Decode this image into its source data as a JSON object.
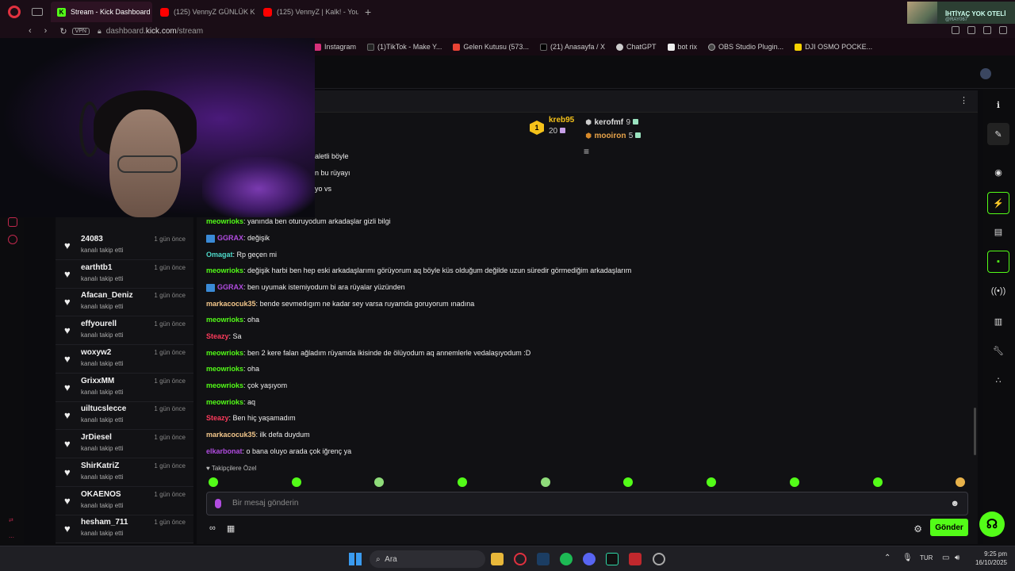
{
  "browser": {
    "tabs": [
      {
        "label": "Stream - Kick Dashboard",
        "icon": "kick-icon",
        "active": true
      },
      {
        "label": "(125) VennyZ GÜNLÜK K",
        "icon": "youtube-icon",
        "active": false
      },
      {
        "label": "(125) VennyZ | Kalk! - You",
        "icon": "youtube-icon",
        "active": false
      }
    ],
    "vpn_label": "VPN",
    "url_prefix": "dashboard.",
    "url_domain": "kick.com",
    "url_path": "/stream",
    "bookmarks": [
      "Instagram",
      "(1)TikTok - Make Y...",
      "Gelen Kutusu (573...",
      "(21) Anasayfa / X",
      "ChatGPT",
      "bot rix",
      "OBS Studio Plugin...",
      "DJI OSMO POCKE..."
    ],
    "notification": {
      "title": "İHTİYAÇ YOK OTELİ",
      "subtitle": "@RAY067"
    }
  },
  "followers": [
    {
      "name": "24083",
      "sub": "kanalı takip etti",
      "time": "1 gün önce"
    },
    {
      "name": "earthtb1",
      "sub": "kanalı takip etti",
      "time": "1 gün önce"
    },
    {
      "name": "Afacan_Deniz",
      "sub": "kanalı takip etti",
      "time": "1 gün önce"
    },
    {
      "name": "effyourell",
      "sub": "kanalı takip etti",
      "time": "1 gün önce"
    },
    {
      "name": "woxyw2",
      "sub": "kanalı takip etti",
      "time": "1 gün önce"
    },
    {
      "name": "GrixxMM",
      "sub": "kanalı takip etti",
      "time": "1 gün önce"
    },
    {
      "name": "uiltucslecce",
      "sub": "kanalı takip etti",
      "time": "1 gün önce"
    },
    {
      "name": "JrDiesel",
      "sub": "kanalı takip etti",
      "time": "1 gün önce"
    },
    {
      "name": "ShirKatriZ",
      "sub": "kanalı takip etti",
      "time": "1 gün önce"
    },
    {
      "name": "OKAENOS",
      "sub": "kanalı takip etti",
      "time": "1 gün önce"
    },
    {
      "name": "hesham_711",
      "sub": "kanalı takip etti",
      "time": "1 gün önce"
    }
  ],
  "leaderboard": [
    {
      "rank": "1",
      "name": "kreb95",
      "value": "20"
    },
    {
      "rank": "2",
      "name": "kerofmf",
      "value": "9"
    },
    {
      "rank": "3",
      "name": "mooiron",
      "value": "5"
    }
  ],
  "chat": {
    "partial_messages": [
      "aletli böyle",
      "n bu rüyayı",
      "yo vs"
    ],
    "messages": [
      {
        "user": "meowrioks",
        "text": "yanında ben oturuyodum arkadaşlar gizli bilgi",
        "color": "#53fc18",
        "badge": false
      },
      {
        "user": "GGRAX",
        "text": "değişik",
        "color": "#b14ce0",
        "badge": true
      },
      {
        "user": "Omagat",
        "text": "Rp geçen mi",
        "color": "#4dd9c9",
        "badge": false
      },
      {
        "user": "meowrioks",
        "text": "değişik harbi ben hep eski arkadaşlarımı görüyorum aq böyle küs olduğum değilde uzun süredir görmediğim arkadaşlarım",
        "color": "#53fc18",
        "badge": false
      },
      {
        "user": "GGRAX",
        "text": "ben uyumak istemiyodum bi ara rüyalar yüzünden",
        "color": "#b14ce0",
        "badge": true
      },
      {
        "user": "markacocuk35",
        "text": "bende sevmedıgım ne kadar sey varsa ruyamda goruyorum ınadına",
        "color": "#f3c78b",
        "badge": false
      },
      {
        "user": "meowrioks",
        "text": "oha",
        "color": "#53fc18",
        "badge": false
      },
      {
        "user": "Steazy",
        "text": "Sa",
        "color": "#ff3b5c",
        "badge": false
      },
      {
        "user": "meowrioks",
        "text": "ben 2 kere falan ağladım rüyamda ikisinde de ölüyodum aq annemlerle vedalaşıyodum :D",
        "color": "#53fc18",
        "badge": false
      },
      {
        "user": "meowrioks",
        "text": "oha",
        "color": "#53fc18",
        "badge": false
      },
      {
        "user": "meowrioks",
        "text": "çok yaşıyom",
        "color": "#53fc18",
        "badge": false
      },
      {
        "user": "meowrioks",
        "text": "aq",
        "color": "#53fc18",
        "badge": false
      },
      {
        "user": "Steazy",
        "text": "Ben hiç yaşamadım",
        "color": "#ff3b5c",
        "badge": false
      },
      {
        "user": "markacocuk35",
        "text": "ilk defa duydum",
        "color": "#f3c78b",
        "badge": false
      },
      {
        "user": "elkarbonat",
        "text": "o bana oluyo arada çok iğrenç ya",
        "color": "#b14ce0",
        "badge": false
      }
    ],
    "followers_only_label": "Takipçilere Özel",
    "input_placeholder": "Bir mesaj gönderin",
    "send_label": "Gönder"
  },
  "taskbar": {
    "search_label": "Ara",
    "lang": "TUR",
    "time": "9:25 pm",
    "date": "16/10/2025"
  }
}
